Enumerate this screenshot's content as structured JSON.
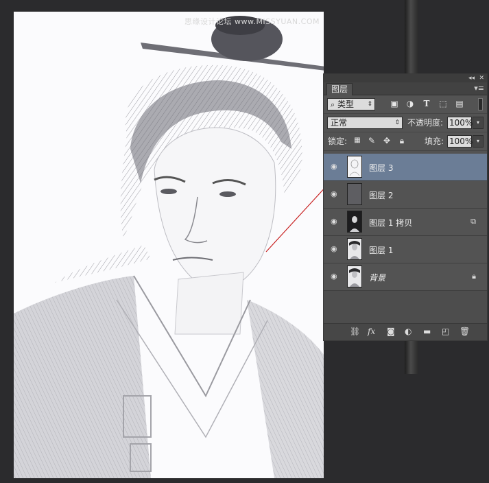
{
  "watermark": "思缘设计论坛 www.MISSYUAN.COM",
  "panel": {
    "collapse_glyph": "◂◂",
    "close_glyph": "✕",
    "tab_label": "图层",
    "menu_glyph": "▾≡",
    "filter": {
      "label": "类型",
      "icon": "search-icon"
    },
    "filter_icons": [
      "image-filter-icon",
      "adjustment-filter-icon",
      "type-filter-icon",
      "shape-filter-icon",
      "smart-object-filter-icon"
    ],
    "blend_mode": "正常",
    "opacity_label": "不透明度:",
    "opacity_value": "100%",
    "lock_label": "锁定:",
    "fill_label": "填充:",
    "fill_value": "100%",
    "layers": [
      {
        "name": "图层 3",
        "selected": true,
        "badge": ""
      },
      {
        "name": "图层 2",
        "selected": false,
        "badge": ""
      },
      {
        "name": "图层 1 拷贝",
        "selected": false,
        "badge": "smart-object"
      },
      {
        "name": "图层 1",
        "selected": false,
        "badge": ""
      },
      {
        "name": "背景",
        "selected": false,
        "badge": "lock"
      }
    ],
    "bottom_icons": [
      "link-icon",
      "fx-icon",
      "mask-icon",
      "adjustment-icon",
      "group-folder-icon",
      "new-layer-icon",
      "trash-icon"
    ],
    "fx_label": "fx"
  }
}
